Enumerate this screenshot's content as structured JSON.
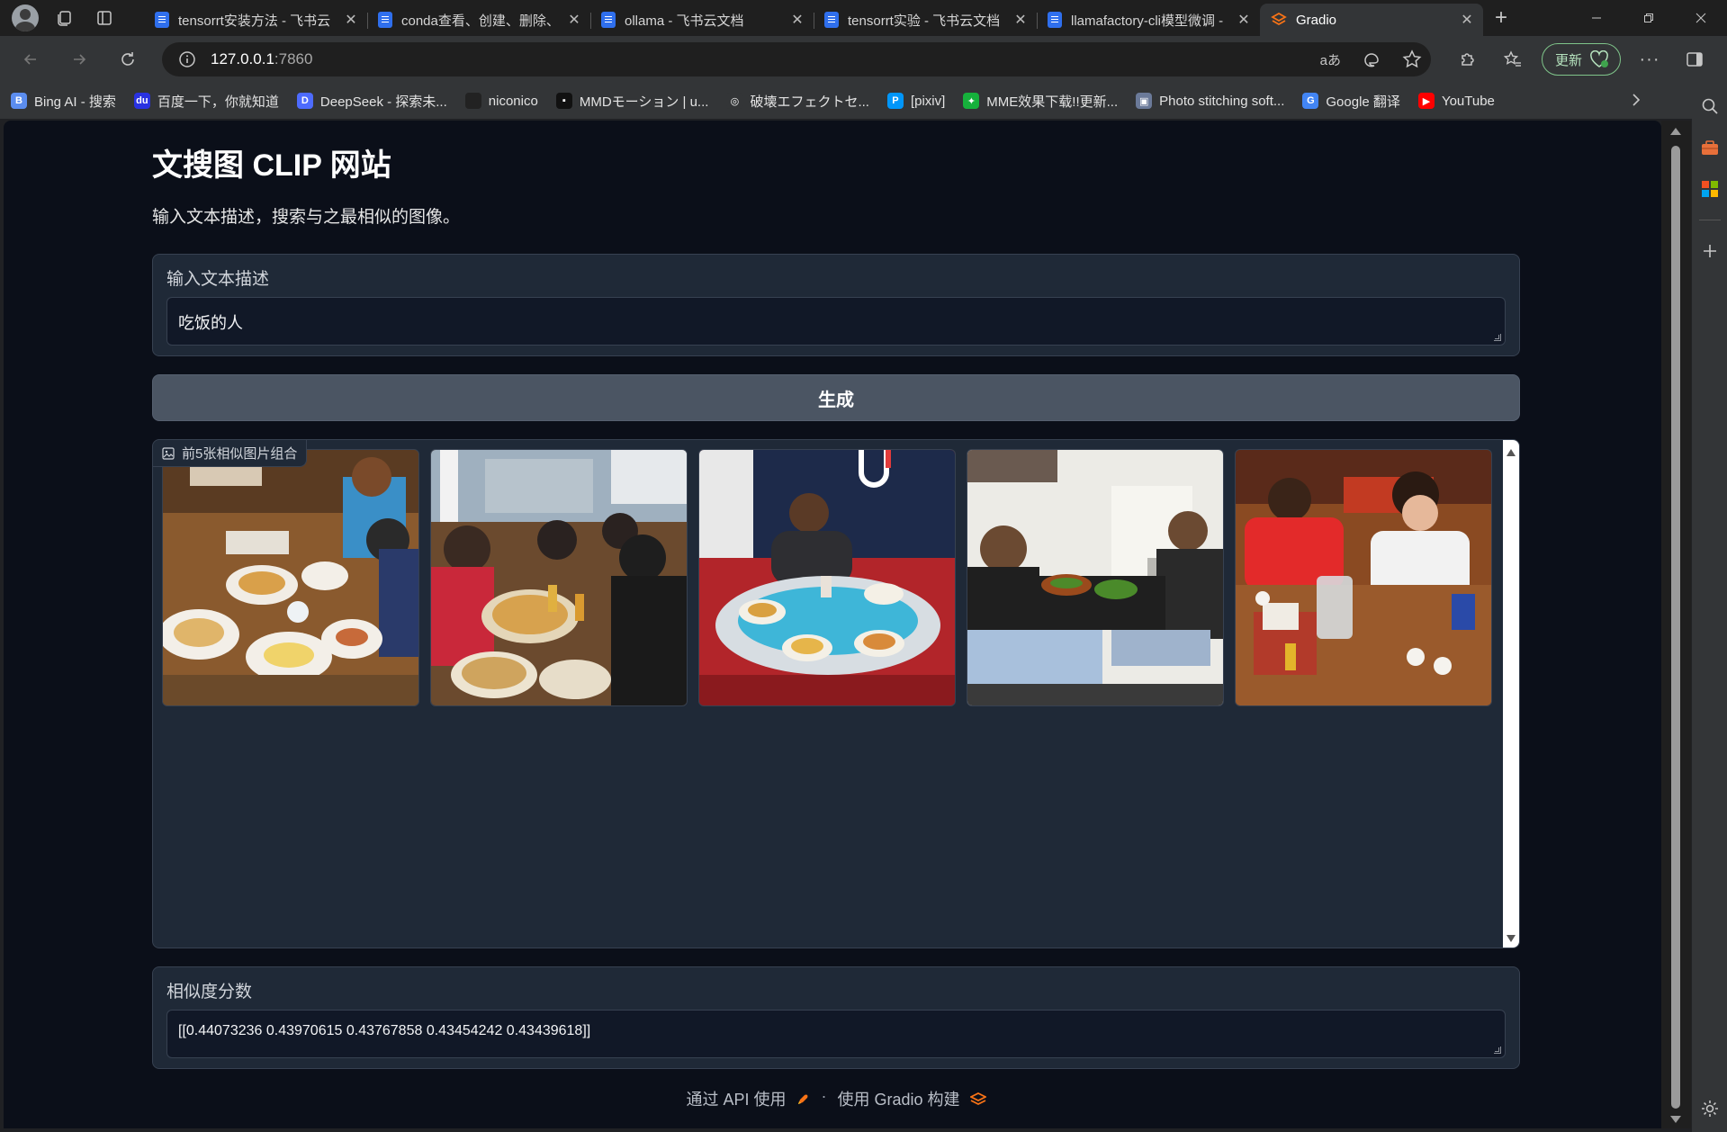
{
  "browser": {
    "tabs": [
      {
        "title": "tensorrt安装方法 - 飞书云",
        "icon": "doc-icon",
        "active": false
      },
      {
        "title": "conda查看、创建、删除、",
        "icon": "doc-icon",
        "active": false
      },
      {
        "title": "ollama - 飞书云文档",
        "icon": "doc-icon",
        "active": false
      },
      {
        "title": "tensorrt实验 - 飞书云文档",
        "icon": "doc-icon",
        "active": false
      },
      {
        "title": "llamafactory-cli模型微调 -",
        "icon": "doc-icon",
        "active": false
      },
      {
        "title": "Gradio",
        "icon": "gradio-icon",
        "active": true
      }
    ],
    "address": {
      "host": "127.0.0.1",
      "port": ":7860"
    },
    "update_label": "更新",
    "bookmarks": [
      {
        "label": "Bing AI - 搜索",
        "color": "#5b8def",
        "glyph": "B"
      },
      {
        "label": "百度一下，你就知道",
        "color": "#2932e1",
        "glyph": "du"
      },
      {
        "label": "DeepSeek - 探索未...",
        "color": "#4d6bfe",
        "glyph": "D"
      },
      {
        "label": "niconico",
        "color": "#222222",
        "glyph": ""
      },
      {
        "label": "MMDモーション | u...",
        "color": "#111111",
        "glyph": "▪"
      },
      {
        "label": "破壊エフェクトセ...",
        "color": "#333537",
        "glyph": "◎"
      },
      {
        "label": "[pixiv]",
        "color": "#0096fa",
        "glyph": "P"
      },
      {
        "label": "MME效果下载!!更新...",
        "color": "#16b13c",
        "glyph": "✦"
      },
      {
        "label": "Photo stitching soft...",
        "color": "#6b7a99",
        "glyph": "▣"
      },
      {
        "label": "Google 翻译",
        "color": "#4285f4",
        "glyph": "G"
      },
      {
        "label": "YouTube",
        "color": "#ff0000",
        "glyph": "▶"
      }
    ]
  },
  "app": {
    "title": "文搜图 CLIP 网站",
    "description": "输入文本描述，搜索与之最相似的图像。",
    "input": {
      "label": "输入文本描述",
      "value": "吃饭的人"
    },
    "generate_button": "生成",
    "gallery": {
      "label": "前5张相似图片组合",
      "images": [
        {
          "alt": "group dining at restaurant table with plates"
        },
        {
          "alt": "friends with sunglasses eating pizza outdoors"
        },
        {
          "alt": "man at round table with plates of food"
        },
        {
          "alt": "two people eating salad in kitchen"
        },
        {
          "alt": "two young men laughing at wooden table"
        }
      ]
    },
    "scores": {
      "label": "相似度分数",
      "value": "[[0.44073236 0.43970615 0.43767858 0.43454242 0.43439618]]"
    },
    "footer": {
      "api": "通过 API 使用",
      "separator": "·",
      "built": "使用 Gradio 构建"
    }
  },
  "colors": {
    "accent": "#f97316",
    "page_bg": "#0b0f19",
    "block_bg": "#1f2937",
    "button_bg": "#4b5563"
  }
}
